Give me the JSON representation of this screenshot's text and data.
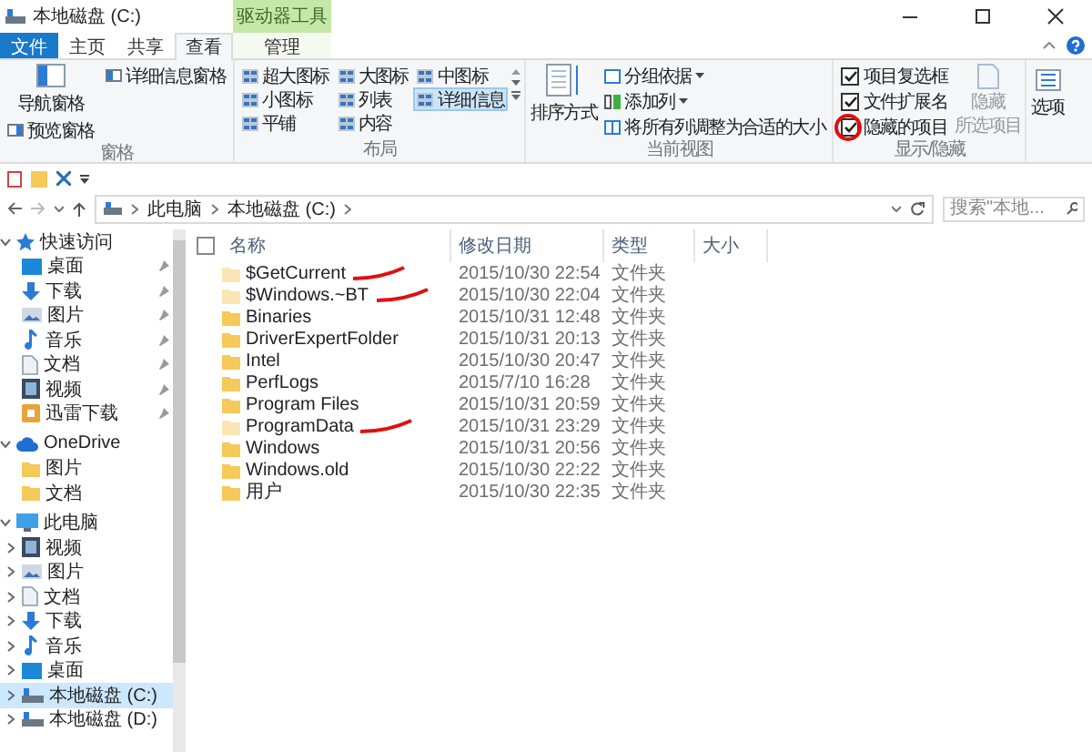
{
  "window": {
    "title": "本地磁盘 (C:)",
    "context_group": "驱动器工具"
  },
  "tabs": [
    {
      "label": "文件",
      "kind": "file",
      "selected": false
    },
    {
      "label": "主页",
      "kind": "normal",
      "selected": false
    },
    {
      "label": "共享",
      "kind": "normal",
      "selected": false
    },
    {
      "label": "查看",
      "kind": "normal",
      "selected": true
    },
    {
      "label": "管理",
      "kind": "context",
      "selected": false
    }
  ],
  "ribbon": {
    "panes": {
      "caption": "窗格",
      "large": "导航窗格",
      "details": "详细信息窗格",
      "preview": "预览窗格"
    },
    "layout": {
      "caption": "布局",
      "items": [
        {
          "label": "超大图标",
          "selected": false
        },
        {
          "label": "大图标",
          "selected": false
        },
        {
          "label": "中图标",
          "selected": false
        },
        {
          "label": "小图标",
          "selected": false
        },
        {
          "label": "列表",
          "selected": false
        },
        {
          "label": "详细信息",
          "selected": true
        },
        {
          "label": "平铺",
          "selected": false
        },
        {
          "label": "内容",
          "selected": false
        }
      ]
    },
    "current_view": {
      "caption": "当前视图",
      "sort": "排序方式",
      "group_by": "分组依据",
      "add_column": "添加列",
      "fit_columns": "将所有列调整为合适的大小"
    },
    "show_hide": {
      "caption": "显示/隐藏",
      "checkboxes": [
        {
          "label": "项目复选框",
          "checked": true,
          "circled": false
        },
        {
          "label": "文件扩展名",
          "checked": true,
          "circled": false
        },
        {
          "label": "隐藏的项目",
          "checked": true,
          "circled": true
        }
      ],
      "hide_button": {
        "line1": "隐藏",
        "line2": "所选项目",
        "disabled": true
      }
    },
    "options": {
      "label": "选项"
    }
  },
  "address": {
    "path": [
      "此电脑",
      "本地磁盘 (C:)"
    ],
    "search_placeholder": "搜索\"本地..."
  },
  "nav": [
    {
      "label": "快速访问",
      "kind": "star",
      "expanded": true,
      "selected": false,
      "children": [
        {
          "label": "桌面",
          "kind": "desktop",
          "pinned": true,
          "selected": false,
          "expandable": false
        },
        {
          "label": "下载",
          "kind": "download",
          "pinned": true,
          "selected": false,
          "expandable": false
        },
        {
          "label": "图片",
          "kind": "pictures",
          "pinned": true,
          "selected": false,
          "expandable": false
        },
        {
          "label": "音乐",
          "kind": "music",
          "pinned": true,
          "selected": false,
          "expandable": false
        },
        {
          "label": "文档",
          "kind": "documents",
          "pinned": true,
          "selected": false,
          "expandable": false
        },
        {
          "label": "视频",
          "kind": "videos",
          "pinned": true,
          "selected": false,
          "expandable": false
        },
        {
          "label": "迅雷下载",
          "kind": "app",
          "pinned": true,
          "selected": false,
          "expandable": false
        }
      ]
    },
    {
      "label": "OneDrive",
      "kind": "cloud",
      "expanded": true,
      "selected": false,
      "children": [
        {
          "label": "图片",
          "kind": "folder",
          "pinned": false,
          "selected": false,
          "expandable": false
        },
        {
          "label": "文档",
          "kind": "folder",
          "pinned": false,
          "selected": false,
          "expandable": false
        }
      ]
    },
    {
      "label": "此电脑",
      "kind": "pc",
      "expanded": true,
      "selected": false,
      "children": [
        {
          "label": "视频",
          "kind": "videos",
          "pinned": false,
          "selected": false,
          "expandable": true
        },
        {
          "label": "图片",
          "kind": "pictures",
          "pinned": false,
          "selected": false,
          "expandable": true
        },
        {
          "label": "文档",
          "kind": "documents",
          "pinned": false,
          "selected": false,
          "expandable": true
        },
        {
          "label": "下载",
          "kind": "download",
          "pinned": false,
          "selected": false,
          "expandable": true
        },
        {
          "label": "音乐",
          "kind": "music",
          "pinned": false,
          "selected": false,
          "expandable": true
        },
        {
          "label": "桌面",
          "kind": "desktop",
          "pinned": false,
          "selected": false,
          "expandable": true
        },
        {
          "label": "本地磁盘 (C:)",
          "kind": "drive",
          "pinned": false,
          "selected": true,
          "expandable": true
        },
        {
          "label": "本地磁盘 (D:)",
          "kind": "drive",
          "pinned": false,
          "selected": false,
          "expandable": true
        }
      ]
    }
  ],
  "table": {
    "select_all_checked": false,
    "columns": [
      "名称",
      "修改日期",
      "类型",
      "大小"
    ],
    "rows": [
      {
        "name": "$GetCurrent",
        "modified": "2015/10/30 22:54",
        "type": "文件夹",
        "hidden": true,
        "underlined": true
      },
      {
        "name": "$Windows.~BT",
        "modified": "2015/10/30 22:04",
        "type": "文件夹",
        "hidden": true,
        "underlined": true
      },
      {
        "name": "Binaries",
        "modified": "2015/10/31 12:48",
        "type": "文件夹",
        "hidden": false,
        "underlined": false
      },
      {
        "name": "DriverExpertFolder",
        "modified": "2015/10/31 20:13",
        "type": "文件夹",
        "hidden": false,
        "underlined": false
      },
      {
        "name": "Intel",
        "modified": "2015/10/30 20:47",
        "type": "文件夹",
        "hidden": false,
        "underlined": false
      },
      {
        "name": "PerfLogs",
        "modified": "2015/7/10 16:28",
        "type": "文件夹",
        "hidden": false,
        "underlined": false
      },
      {
        "name": "Program Files",
        "modified": "2015/10/31 20:59",
        "type": "文件夹",
        "hidden": false,
        "underlined": false
      },
      {
        "name": "ProgramData",
        "modified": "2015/10/31 23:29",
        "type": "文件夹",
        "hidden": true,
        "underlined": true
      },
      {
        "name": "Windows",
        "modified": "2015/10/31 20:56",
        "type": "文件夹",
        "hidden": false,
        "underlined": false
      },
      {
        "name": "Windows.old",
        "modified": "2015/10/30 22:22",
        "type": "文件夹",
        "hidden": false,
        "underlined": false
      },
      {
        "name": "用户",
        "modified": "2015/10/30 22:35",
        "type": "文件夹",
        "hidden": false,
        "underlined": false
      }
    ]
  }
}
